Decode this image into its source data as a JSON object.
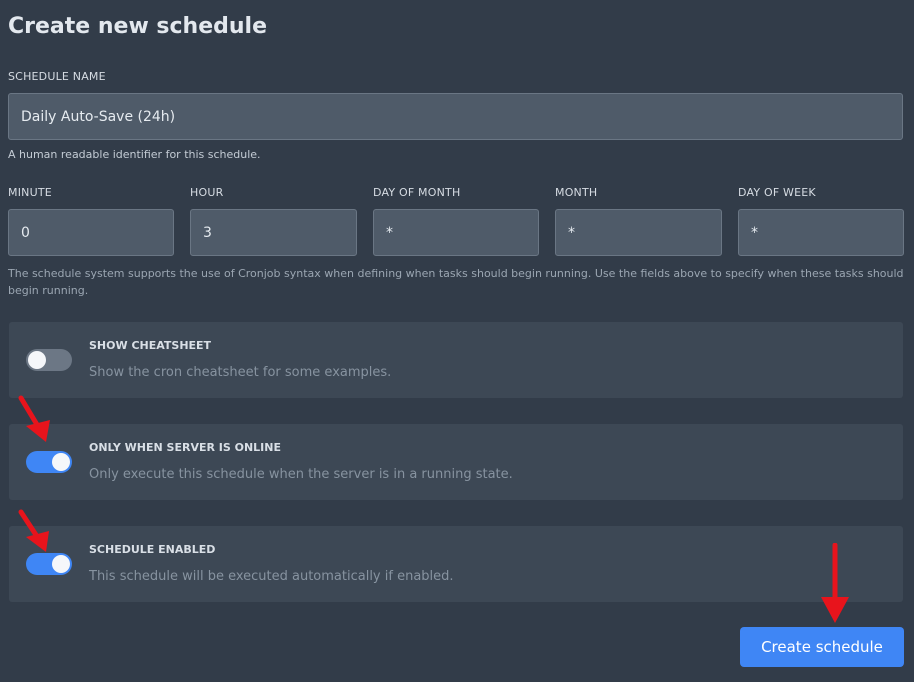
{
  "page": {
    "title": "Create new schedule"
  },
  "form": {
    "name": {
      "label": "SCHEDULE NAME",
      "value": "Daily Auto-Save (24h)",
      "help": "A human readable identifier for this schedule."
    },
    "cron": {
      "minute": {
        "label": "MINUTE",
        "value": "0"
      },
      "hour": {
        "label": "HOUR",
        "value": "3"
      },
      "day_of_month": {
        "label": "DAY OF MONTH",
        "value": "*"
      },
      "month": {
        "label": "MONTH",
        "value": "*"
      },
      "day_of_week": {
        "label": "DAY OF WEEK",
        "value": "*"
      },
      "help": "The schedule system supports the use of Cronjob syntax when defining when tasks should begin running. Use the fields above to specify when these tasks should begin running."
    }
  },
  "toggles": {
    "cheatsheet": {
      "title": "SHOW CHEATSHEET",
      "description": "Show the cron cheatsheet for some examples.",
      "enabled": false
    },
    "only_online": {
      "title": "ONLY WHEN SERVER IS ONLINE",
      "description": "Only execute this schedule when the server is in a running state.",
      "enabled": true
    },
    "schedule_enabled": {
      "title": "SCHEDULE ENABLED",
      "description": "This schedule will be executed automatically if enabled.",
      "enabled": true
    }
  },
  "actions": {
    "create_label": "Create schedule"
  },
  "colors": {
    "background": "#323c49",
    "panel": "#3d4855",
    "accent": "#3f86f5",
    "annotation_arrow": "#e8141c"
  },
  "icons": {
    "annotation": "red-arrow-icon"
  }
}
